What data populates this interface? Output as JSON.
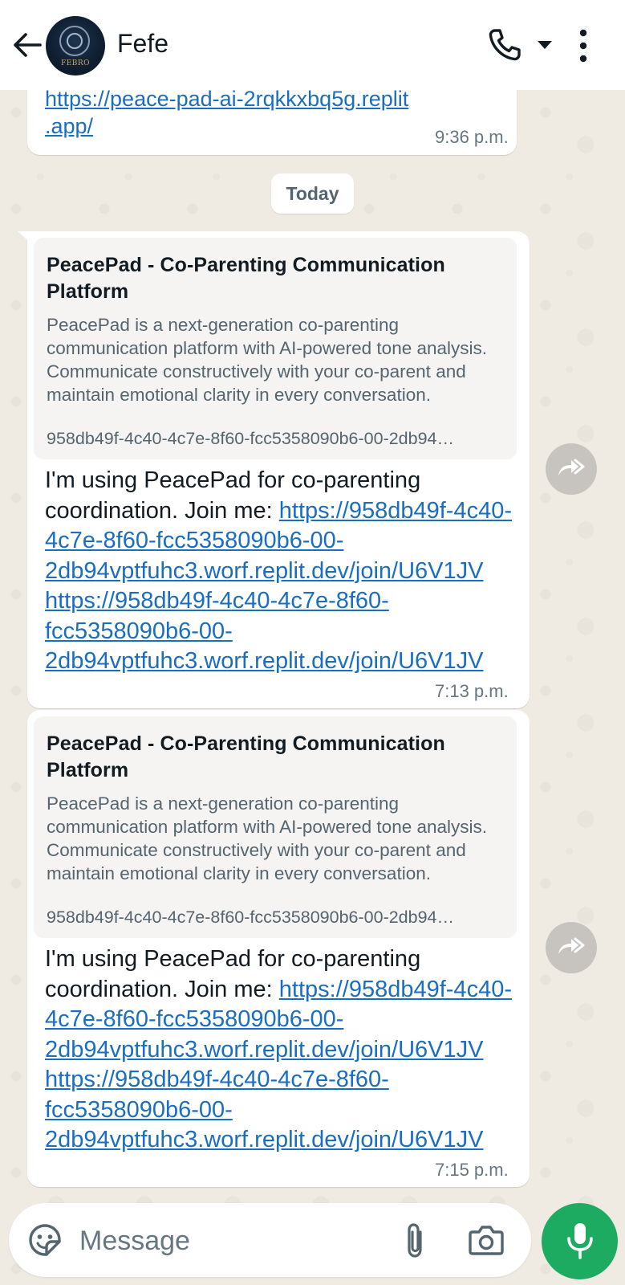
{
  "header": {
    "contact_name": "Fefe",
    "avatar_text": "FEBRO"
  },
  "messages": [
    {
      "link_part1": "https://peace-pad-ai-2rqkkxbq5g.replit",
      "link_part2": ".app/",
      "time": "9:36 p.m."
    }
  ],
  "day_separator": "Today",
  "shared": [
    {
      "preview_title": "PeacePad - Co-Parenting Communication Platform",
      "preview_description": "PeacePad is a next-generation co-parenting communication platform with AI-powered tone analysis. Communicate constructively with your co-parent and maintain emotional clarity in every conversation.",
      "preview_domain": "958db49f-4c40-4c7e-8f60-fcc5358090b6-00-2db94…",
      "text_intro": "I'm using PeacePad for co-parenting coordination. Join me: ",
      "link1": "https://958db49f-4c40-4c7e-8f60-fcc5358090b6-00-2db94vptfuhc3.worf.replit.dev/join/U6V1JV",
      "link2": "https://958db49f-4c40-4c7e-8f60-fcc5358090b6-00-2db94vptfuhc3.worf.replit.dev/join/U6V1JV",
      "time": "7:13 p.m."
    },
    {
      "preview_title": "PeacePad - Co-Parenting Communication Platform",
      "preview_description": "PeacePad is a next-generation co-parenting communication platform with AI-powered tone analysis. Communicate constructively with your co-parent and maintain emotional clarity in every conversation.",
      "preview_domain": "958db49f-4c40-4c7e-8f60-fcc5358090b6-00-2db94…",
      "text_intro": "I'm using PeacePad for co-parenting coordination. Join me: ",
      "link1": "https://958db49f-4c40-4c7e-8f60-fcc5358090b6-00-2db94vptfuhc3.worf.replit.dev/join/U6V1JV",
      "link2": "https://958db49f-4c40-4c7e-8f60-fcc5358090b6-00-2db94vptfuhc3.worf.replit.dev/join/U6V1JV",
      "time": "7:15 p.m."
    }
  ],
  "composer": {
    "placeholder": "Message"
  },
  "icons": {
    "back": "arrow-left-icon",
    "call": "phone-icon",
    "dropdown": "caret-down-icon",
    "menu": "kebab-menu-icon",
    "forward": "forward-icon",
    "sticker": "sticker-icon",
    "attach": "paperclip-icon",
    "camera": "camera-icon",
    "mic": "microphone-icon"
  },
  "colors": {
    "accent_green": "#1daa61",
    "link_blue": "#1a6ec2",
    "chat_background": "#efeae2"
  }
}
